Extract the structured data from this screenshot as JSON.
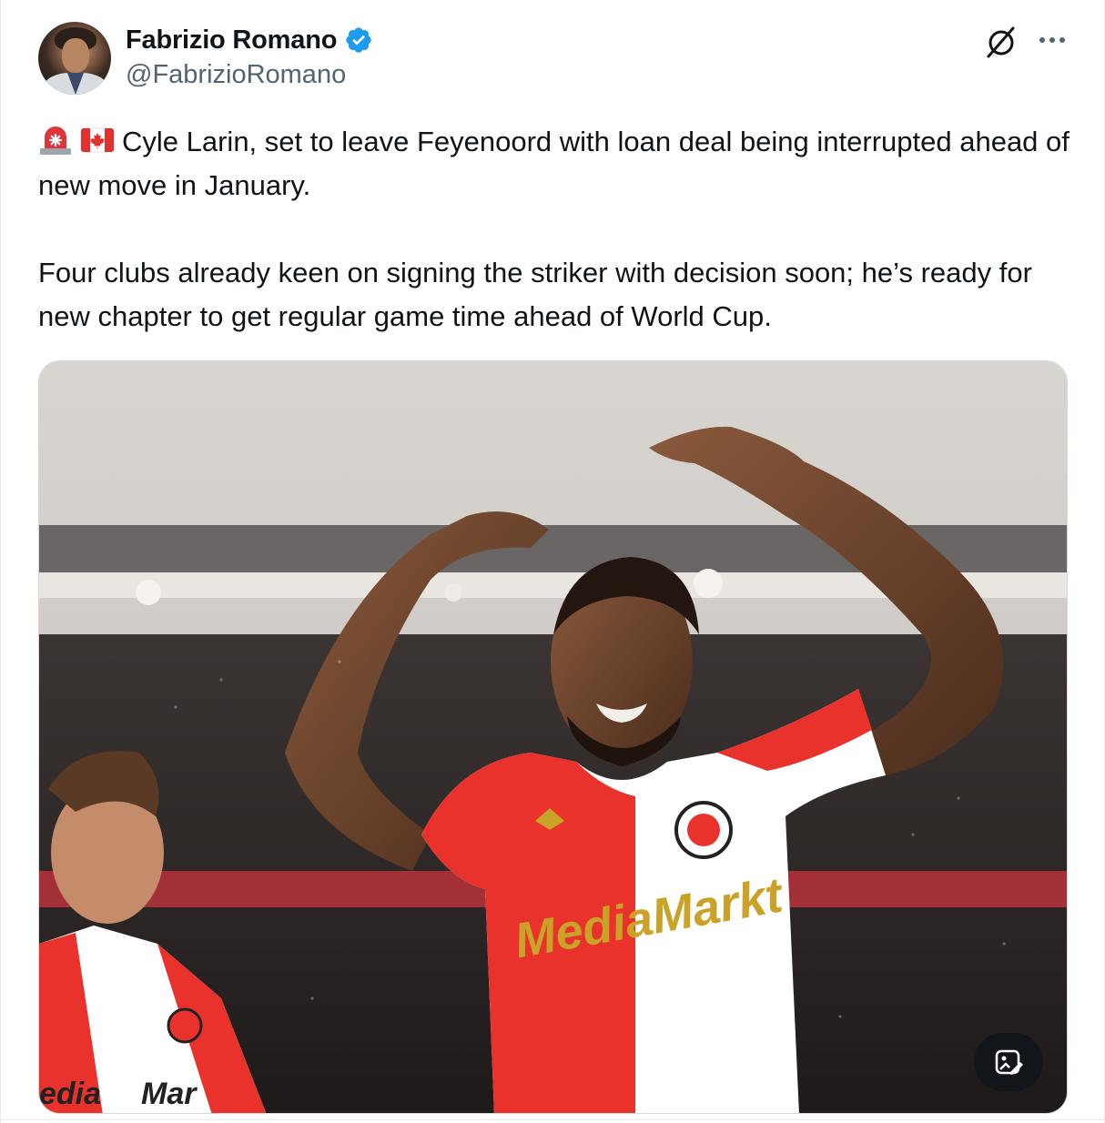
{
  "author": {
    "display_name": "Fabrizio Romano",
    "handle": "@FabrizioRomano",
    "verified": true
  },
  "header_actions": {
    "grok_icon": "grok-slash-circle-icon",
    "more_icon": "more-dots-icon"
  },
  "tweet": {
    "emojis": [
      "rotating-light-emoji",
      "canada-flag-emoji"
    ],
    "line1": "Cyle Larin, set to leave Feyenoord with loan deal being interrupted ahead of new move in January.",
    "line2": "Four clubs already keen on signing the striker with decision soon; he’s ready for new chapter to get regular game time ahead of World Cup."
  },
  "media": {
    "jersey_sponsor": "MediaMarkt",
    "edit_icon": "image-edit-icon"
  },
  "colors": {
    "text_primary": "#0f1419",
    "text_secondary": "#536471",
    "verified_blue": "#1d9bf0",
    "border": "#cfd9de",
    "feyenoord_red": "#e8322b"
  }
}
